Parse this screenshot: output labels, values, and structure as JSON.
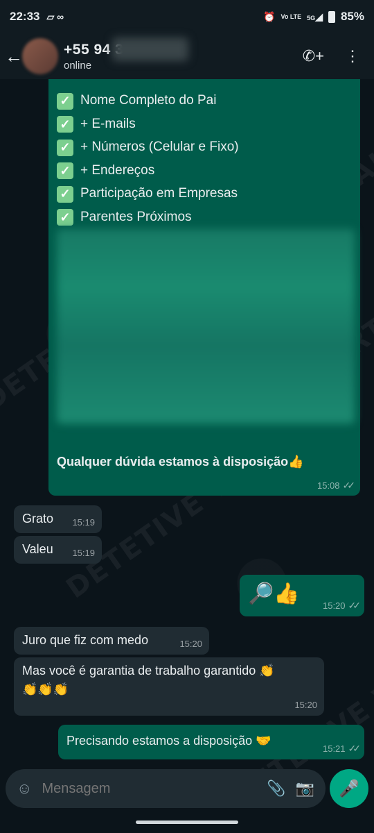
{
  "status_bar": {
    "time": "22:33",
    "battery": "85%",
    "network": "5G",
    "lte": "Vo LTE"
  },
  "header": {
    "contact_name": "+55 94 3",
    "contact_status": "online"
  },
  "report_bubble": {
    "items": [
      "Nome Completo do Pai",
      "+ E-mails",
      "+ Números (Celular e Fixo)",
      "+ Endereços",
      "Participação em Empresas",
      "Parentes Próximos"
    ],
    "footer": "Qualquer dúvida estamos à disposição👍",
    "time": "15:08"
  },
  "messages": [
    {
      "text": "Grato",
      "time": "15:19"
    },
    {
      "text": "Valeu",
      "time": "15:19"
    },
    {
      "text": "🔎👍",
      "time": "15:20"
    },
    {
      "text": "Juro que fiz com medo",
      "time": "15:20"
    },
    {
      "text": "Mas você é garantia de trabalho garantido 👏",
      "text2": "👏👏👏",
      "time": "15:20"
    },
    {
      "text": "Precisando estamos a disposição 🤝",
      "time": "15:21"
    }
  ],
  "watermark": "DETETIVE VIRTUAL",
  "input": {
    "placeholder": "Mensagem"
  },
  "colors": {
    "incoming": "#202c33",
    "outgoing": "#005c4b",
    "accent": "#00a884"
  }
}
